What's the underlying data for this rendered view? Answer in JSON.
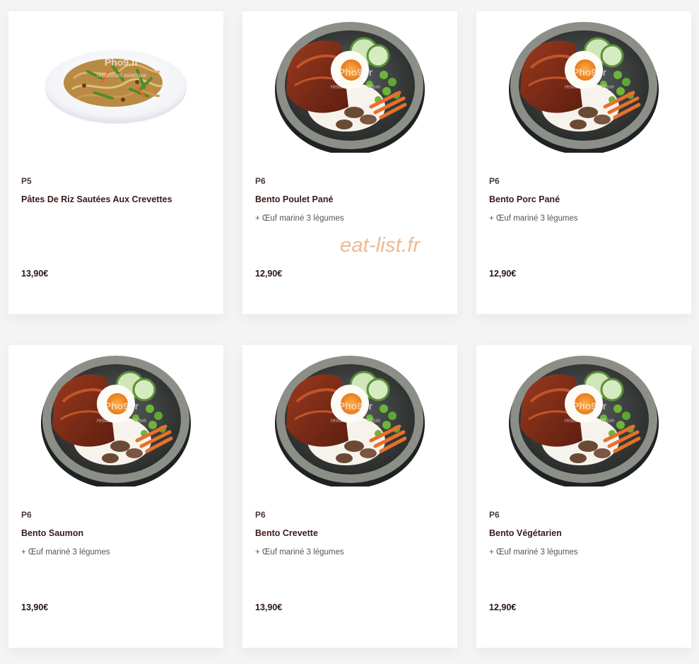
{
  "watermark": "eat-list.fr",
  "image_watermark": "Pho9.fr",
  "image_watermark_sub": "restaurant asiatique",
  "menu": [
    {
      "code": "P5",
      "name": "Pâtes De Riz Sautées Aux Crevettes",
      "description": "",
      "price": "13,90€",
      "image": "noodle-plate"
    },
    {
      "code": "P6",
      "name": "Bento Poulet Pané",
      "description": "+ Œuf mariné 3 légumes",
      "price": "12,90€",
      "image": "bento-bowl"
    },
    {
      "code": "P6",
      "name": "Bento Porc Pané",
      "description": "+ Œuf mariné 3 légumes",
      "price": "12,90€",
      "image": "bento-bowl"
    },
    {
      "code": "P6",
      "name": "Bento Saumon",
      "description": "+ Œuf mariné 3 légumes",
      "price": "13,90€",
      "image": "bento-bowl"
    },
    {
      "code": "P6",
      "name": "Bento Crevette",
      "description": "+ Œuf mariné 3 légumes",
      "price": "13,90€",
      "image": "bento-bowl"
    },
    {
      "code": "P6",
      "name": "Bento Végétarien",
      "description": "+ Œuf mariné 3 légumes",
      "price": "12,90€",
      "image": "bento-bowl"
    }
  ]
}
